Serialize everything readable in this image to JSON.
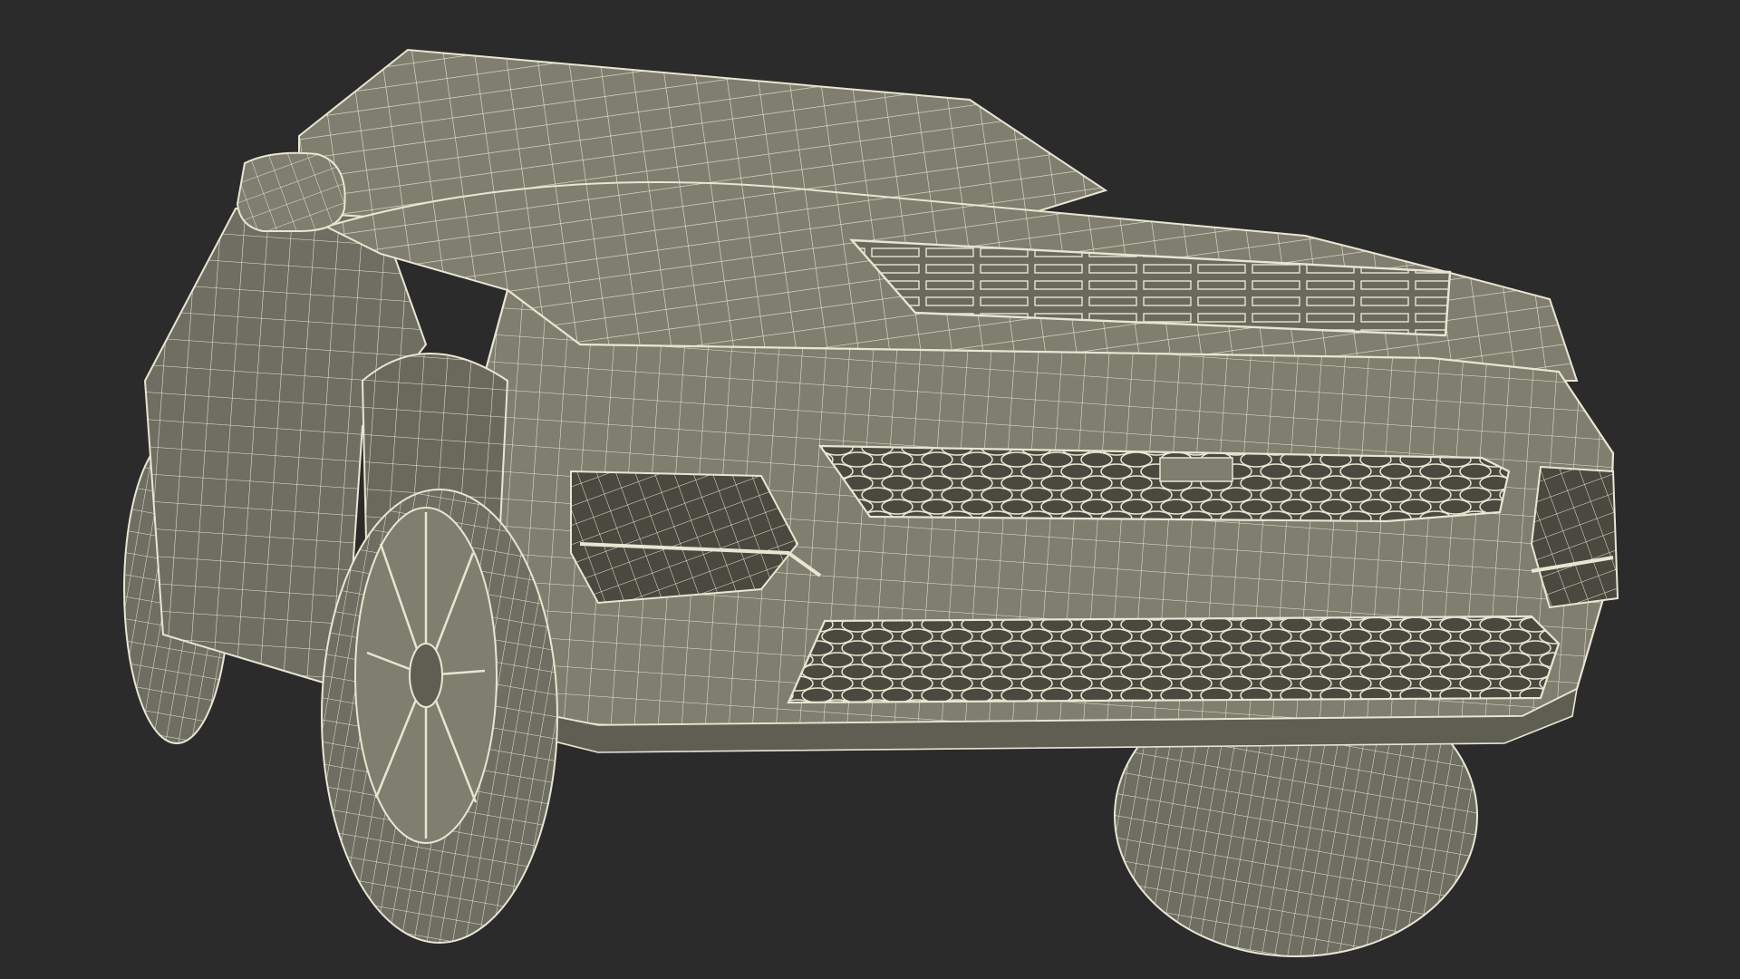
{
  "scene": {
    "subject": "suv-wireframe-render",
    "view": "front-three-quarter-low",
    "colors": {
      "background": "#2b2b2b",
      "body": "#7f7e6f",
      "body_shadow": "#5f5e52",
      "body_light": "#8f8e7f",
      "wire": "#e8e6d2",
      "wire_dense": "#d9d7c2",
      "tire": "#6f6e62",
      "cavity": "#4a4940"
    }
  }
}
